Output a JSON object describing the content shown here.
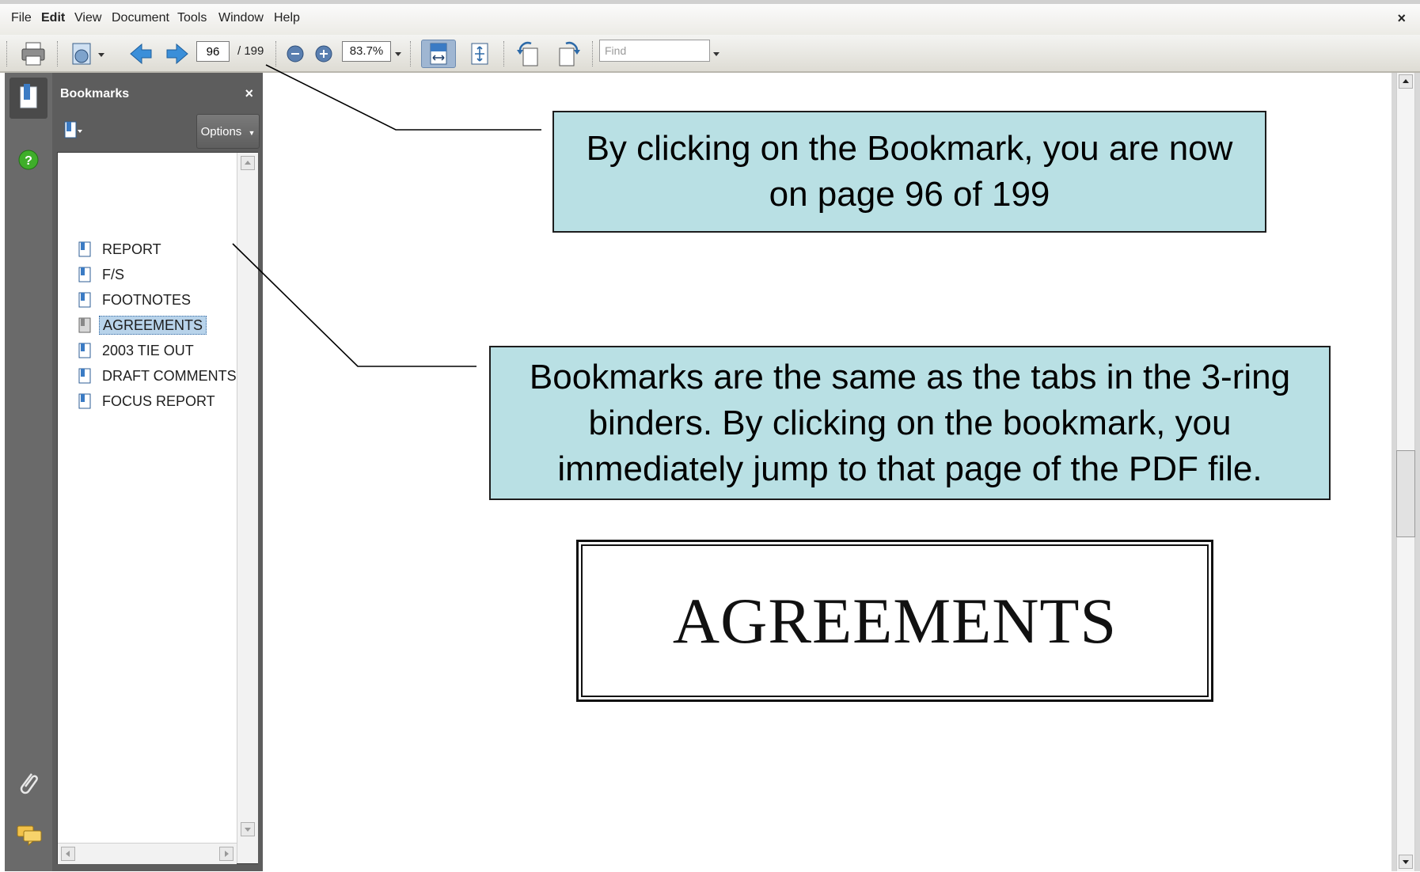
{
  "menu": {
    "items": [
      "File",
      "Edit",
      "View",
      "Document",
      "Tools",
      "Window",
      "Help"
    ],
    "close": "×"
  },
  "toolbar": {
    "current_page": "96",
    "total_pages": "/ 199",
    "zoom": "83.7%",
    "find_placeholder": "Find"
  },
  "bookmarks_panel": {
    "title": "Bookmarks",
    "close": "×",
    "options_label": "Options",
    "items": [
      {
        "label": "REPORT",
        "selected": false
      },
      {
        "label": "F/S",
        "selected": false
      },
      {
        "label": "FOOTNOTES",
        "selected": false
      },
      {
        "label": "AGREEMENTS",
        "selected": true
      },
      {
        "label": "2003 TIE OUT",
        "selected": false
      },
      {
        "label": "DRAFT COMMENTS",
        "selected": false
      },
      {
        "label": "FOCUS REPORT",
        "selected": false
      }
    ]
  },
  "callouts": {
    "page_note": "By clicking on the Bookmark, you are now on page 96 of 199",
    "bookmark_note": "Bookmarks are the same as the tabs in the 3-ring binders.  By clicking on the bookmark, you immediately jump to that page of the PDF file."
  },
  "document": {
    "heading": "AGREEMENTS"
  },
  "colors": {
    "callout_fill": "#b9e0e4",
    "panel_bg": "#5d5d5d",
    "selection": "#b8d3ea"
  }
}
